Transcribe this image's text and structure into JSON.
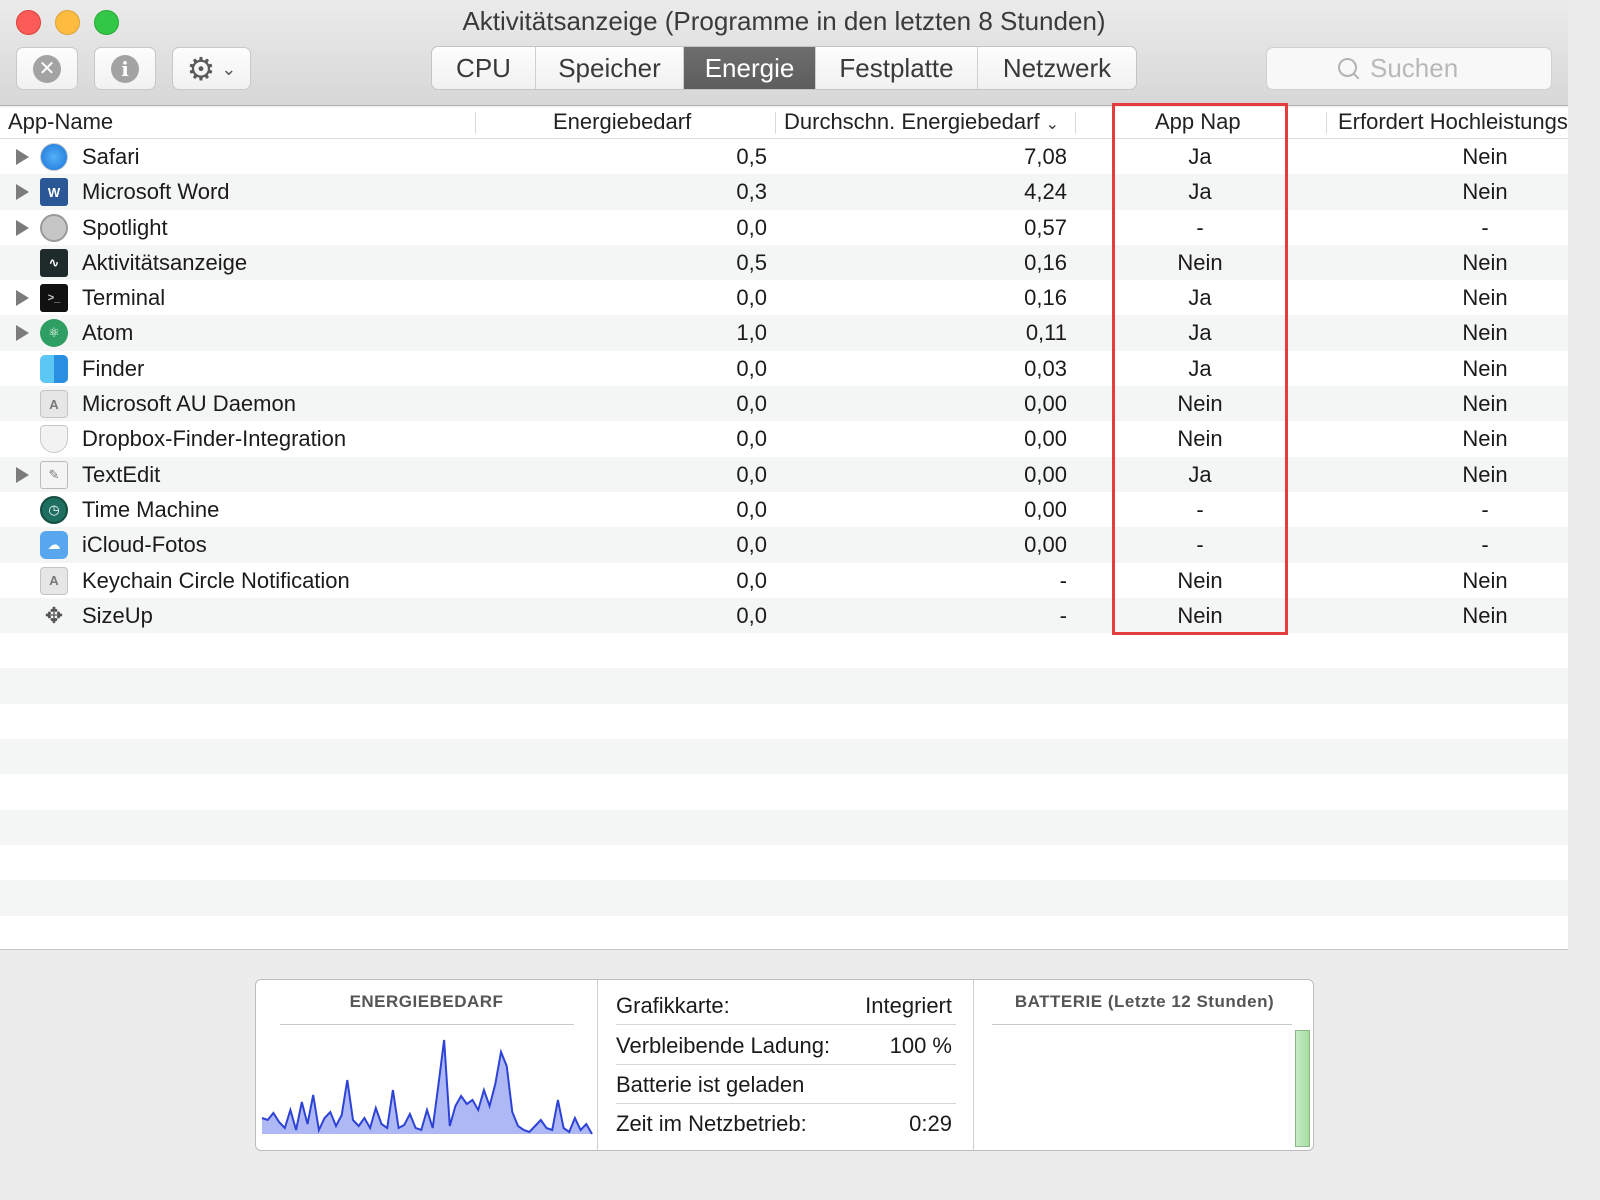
{
  "window": {
    "title": "Aktivitätsanzeige (Programme in den letzten 8 Stunden)"
  },
  "toolbar": {
    "stop_icon": "x-circle-icon",
    "info_icon": "info-circle-icon",
    "gear_icon": "gear-icon"
  },
  "tabs": [
    {
      "label": "CPU",
      "active": false
    },
    {
      "label": "Speicher",
      "active": false
    },
    {
      "label": "Energie",
      "active": true
    },
    {
      "label": "Festplatte",
      "active": false
    },
    {
      "label": "Netzwerk",
      "active": false
    }
  ],
  "search": {
    "placeholder": "Suchen",
    "value": ""
  },
  "table": {
    "columns": {
      "name": "App-Name",
      "energy": "Energiebedarf",
      "avg_energy": "Durchschn. Energiebedarf",
      "app_nap": "App Nap",
      "high_perf": "Erfordert Hochleistungs"
    },
    "rows": [
      {
        "name": "Safari",
        "icon": "safari-icon",
        "expandable": true,
        "energy": "0,5",
        "avg": "7,08",
        "nap": "Ja",
        "hoch": "Nein"
      },
      {
        "name": "Microsoft Word",
        "icon": "word-icon",
        "expandable": true,
        "energy": "0,3",
        "avg": "4,24",
        "nap": "Ja",
        "hoch": "Nein"
      },
      {
        "name": "Spotlight",
        "icon": "spotlight-icon",
        "expandable": true,
        "energy": "0,0",
        "avg": "0,57",
        "nap": "-",
        "hoch": "-"
      },
      {
        "name": "Aktivitätsanzeige",
        "icon": "activity-monitor-icon",
        "expandable": false,
        "energy": "0,5",
        "avg": "0,16",
        "nap": "Nein",
        "hoch": "Nein"
      },
      {
        "name": "Terminal",
        "icon": "terminal-icon",
        "expandable": true,
        "energy": "0,0",
        "avg": "0,16",
        "nap": "Ja",
        "hoch": "Nein"
      },
      {
        "name": "Atom",
        "icon": "atom-icon",
        "expandable": true,
        "energy": "1,0",
        "avg": "0,11",
        "nap": "Ja",
        "hoch": "Nein"
      },
      {
        "name": "Finder",
        "icon": "finder-icon",
        "expandable": false,
        "energy": "0,0",
        "avg": "0,03",
        "nap": "Ja",
        "hoch": "Nein"
      },
      {
        "name": "Microsoft AU Daemon",
        "icon": "app-generic-icon",
        "expandable": false,
        "energy": "0,0",
        "avg": "0,00",
        "nap": "Nein",
        "hoch": "Nein"
      },
      {
        "name": "Dropbox-Finder-Integration",
        "icon": "shield-icon",
        "expandable": false,
        "energy": "0,0",
        "avg": "0,00",
        "nap": "Nein",
        "hoch": "Nein"
      },
      {
        "name": "TextEdit",
        "icon": "textedit-icon",
        "expandable": true,
        "energy": "0,0",
        "avg": "0,00",
        "nap": "Ja",
        "hoch": "Nein"
      },
      {
        "name": "Time Machine",
        "icon": "time-machine-icon",
        "expandable": false,
        "energy": "0,0",
        "avg": "0,00",
        "nap": "-",
        "hoch": "-"
      },
      {
        "name": "iCloud-Fotos",
        "icon": "icloud-icon",
        "expandable": false,
        "energy": "0,0",
        "avg": "0,00",
        "nap": "-",
        "hoch": "-"
      },
      {
        "name": "Keychain Circle Notification",
        "icon": "app-generic-icon",
        "expandable": false,
        "energy": "0,0",
        "avg": "-",
        "nap": "Nein",
        "hoch": "Nein"
      },
      {
        "name": "SizeUp",
        "icon": "sizeup-icon",
        "expandable": false,
        "energy": "0,0",
        "avg": "-",
        "nap": "Nein",
        "hoch": "Nein"
      }
    ]
  },
  "bottom": {
    "energy_title": "ENERGIEBEDARF",
    "battery_title": "BATTERIE (Letzte 12 Stunden)",
    "stats": [
      {
        "label": "Grafikkarte:",
        "value": "Integriert"
      },
      {
        "label": "Verbleibende Ladung:",
        "value": "100 %"
      },
      {
        "label": "Batterie ist geladen",
        "value": ""
      },
      {
        "label": "Zeit im Netzbetrieb:",
        "value": "0:29"
      }
    ],
    "battery_level": 1.0
  },
  "colors": {
    "highlight": "#e53d3d",
    "chart_line": "#2d43d6",
    "chart_fill": "#aeb8f5",
    "active_tab": "#666666"
  }
}
